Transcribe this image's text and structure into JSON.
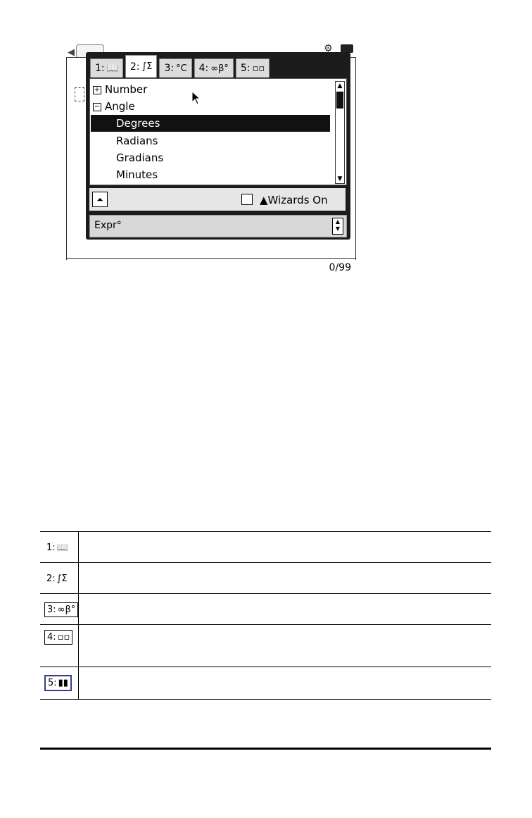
{
  "catalog": {
    "tabs": [
      {
        "label": "1:",
        "icon": "catalog-book-icon",
        "glyph": "📖"
      },
      {
        "label": "2:",
        "icon": "integral-sigma-icon",
        "glyph": "∫Σ"
      },
      {
        "label": "3:",
        "icon": "unit-conversion-icon",
        "glyph": "°C"
      },
      {
        "label": "4:",
        "icon": "symbols-icon",
        "glyph": "∞β°"
      },
      {
        "label": "5:",
        "icon": "templates-icon",
        "glyph": "▫▫"
      }
    ],
    "items": [
      {
        "label": "Number",
        "toggle": "+",
        "level": 0
      },
      {
        "label": "Angle",
        "toggle": "−",
        "level": 0
      },
      {
        "label": "Degrees",
        "level": 1,
        "selected": true
      },
      {
        "label": "Radians",
        "level": 1
      },
      {
        "label": "Gradians",
        "level": 1
      },
      {
        "label": "Minutes",
        "level": 1
      }
    ],
    "wizards_label": "▲Wizards On",
    "wizards_checked": false,
    "expr_text": "Expr°"
  },
  "status": {
    "counter": "0/99"
  },
  "table": {
    "rows": [
      {
        "label": "1:",
        "glyph": "📖",
        "icon": "catalog-book-icon",
        "frame": "none"
      },
      {
        "label": "2:",
        "glyph": "∫Σ",
        "icon": "integral-sigma-icon",
        "frame": "none"
      },
      {
        "label": "3:",
        "glyph": "∞β°",
        "icon": "symbols-icon",
        "frame": "boxed"
      },
      {
        "label": "4:",
        "glyph": "▫▫",
        "icon": "templates-icon",
        "frame": "boxed"
      },
      {
        "label": "5:",
        "glyph": "▮▮",
        "icon": "libraries-icon",
        "frame": "blue"
      }
    ]
  }
}
